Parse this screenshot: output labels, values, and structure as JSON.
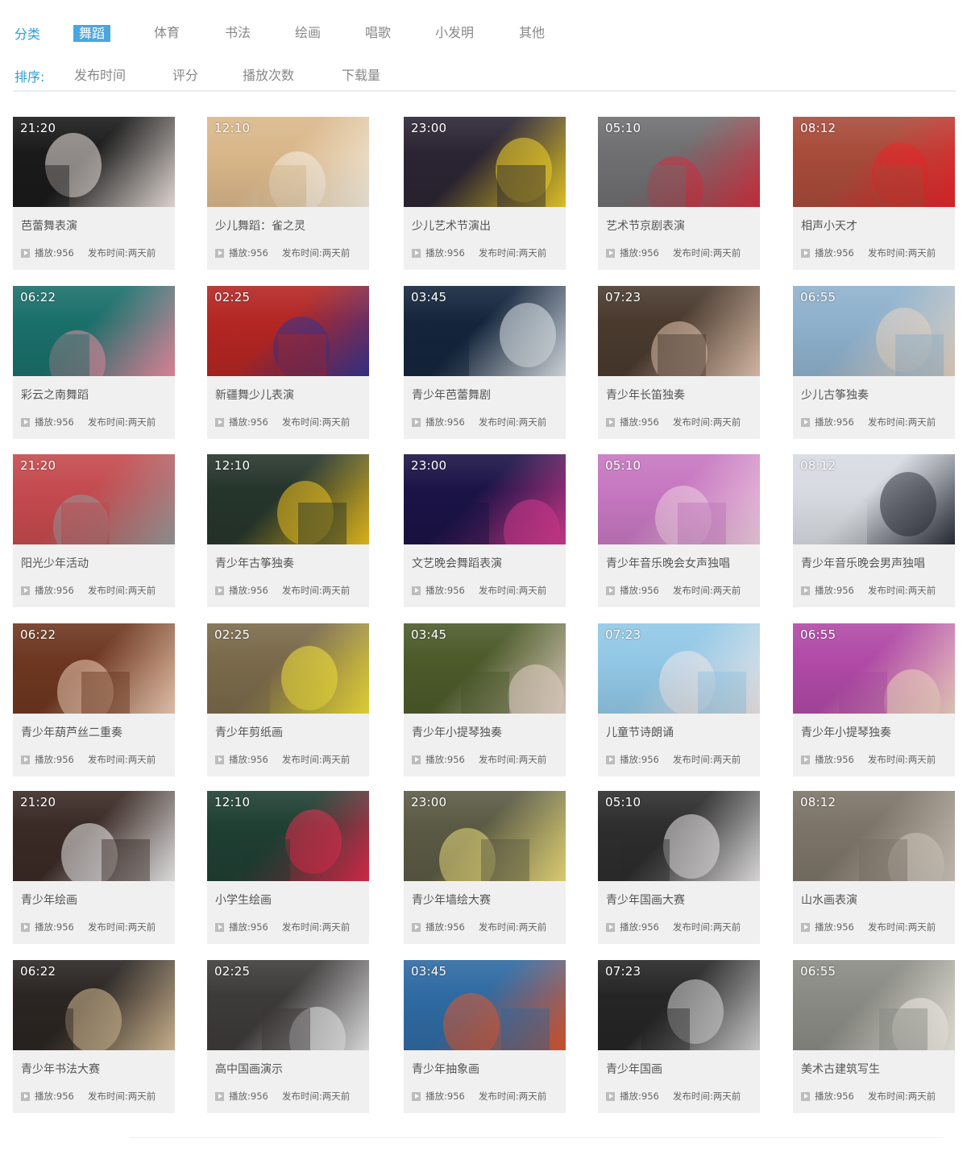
{
  "filters": {
    "category_label": "分类",
    "categories": [
      "舞蹈",
      "体育",
      "书法",
      "绘画",
      "唱歌",
      "小发明",
      "其他"
    ],
    "active_category": "舞蹈",
    "sort_label": "排序:",
    "sort_options": [
      "发布时间",
      "评分",
      "播放次数",
      "下载量"
    ]
  },
  "meta_labels": {
    "plays": "播放:",
    "published": "发布时间:"
  },
  "colors": {
    "accent": "#4aa6e0",
    "label": "#2a9fd8",
    "card_bg": "#f1f0f0"
  },
  "videos": [
    {
      "title": "芭蕾舞表演",
      "duration": "21:20",
      "plays": "956",
      "published": "两天前",
      "c1": "#1a1a1a",
      "c2": "#f3e9e4"
    },
    {
      "title": "少儿舞蹈：雀之灵",
      "duration": "12:10",
      "plays": "956",
      "published": "两天前",
      "c1": "#d9b78a",
      "c2": "#f7efe1"
    },
    {
      "title": "少儿艺术节演出",
      "duration": "23:00",
      "plays": "956",
      "published": "两天前",
      "c1": "#2b2533",
      "c2": "#f2d22a"
    },
    {
      "title": "艺术节京剧表演",
      "duration": "05:10",
      "plays": "956",
      "published": "两天前",
      "c1": "#6f6e70",
      "c2": "#d32f3f"
    },
    {
      "title": "相声小天才",
      "duration": "08:12",
      "plays": "956",
      "published": "两天前",
      "c1": "#a84b3a",
      "c2": "#e8242a"
    },
    {
      "title": "彩云之南舞蹈",
      "duration": "06:22",
      "plays": "956",
      "published": "两天前",
      "c1": "#1a6f6b",
      "c2": "#ef8fa4"
    },
    {
      "title": "新疆舞少儿表演",
      "duration": "02:25",
      "plays": "956",
      "published": "两天前",
      "c1": "#b32623",
      "c2": "#35338e"
    },
    {
      "title": "青少年芭蕾舞剧",
      "duration": "03:45",
      "plays": "956",
      "published": "两天前",
      "c1": "#14253c",
      "c2": "#dfe6ea"
    },
    {
      "title": "青少年长笛独奏",
      "duration": "07:23",
      "plays": "956",
      "published": "两天前",
      "c1": "#4a3a2e",
      "c2": "#e6c7b1"
    },
    {
      "title": "少儿古筝独奏",
      "duration": "06:55",
      "plays": "956",
      "published": "两天前",
      "c1": "#8fb1cc",
      "c2": "#e5d3c2"
    },
    {
      "title": "阳光少年活动",
      "duration": "21:20",
      "plays": "956",
      "published": "两天前",
      "c1": "#c44a4e",
      "c2": "#9a9a9a"
    },
    {
      "title": "青少年古筝独奏",
      "duration": "12:10",
      "plays": "956",
      "published": "两天前",
      "c1": "#26352c",
      "c2": "#f0c21f"
    },
    {
      "title": "文艺晚会舞蹈表演",
      "duration": "23:00",
      "plays": "956",
      "published": "两天前",
      "c1": "#1b1346",
      "c2": "#d63b8f"
    },
    {
      "title": "青少年音乐晚会女声独唱",
      "duration": "05:10",
      "plays": "956",
      "published": "两天前",
      "c1": "#c677c0",
      "c2": "#f1cfe2"
    },
    {
      "title": "青少年音乐晚会男声独唱",
      "duration": "08:12",
      "plays": "956",
      "published": "两天前",
      "c1": "#d7dbe1",
      "c2": "#2b2e38"
    },
    {
      "title": "青少年葫芦丝二重奏",
      "duration": "06:22",
      "plays": "956",
      "published": "两天前",
      "c1": "#6d3720",
      "c2": "#f3d0b8"
    },
    {
      "title": "青少年剪纸画",
      "duration": "02:25",
      "plays": "956",
      "published": "两天前",
      "c1": "#7a6a4b",
      "c2": "#f3e23a"
    },
    {
      "title": "青少年小提琴独奏",
      "duration": "03:45",
      "plays": "956",
      "published": "两天前",
      "c1": "#4c5a2a",
      "c2": "#e7d6c9"
    },
    {
      "title": "儿童节诗朗诵",
      "duration": "07:23",
      "plays": "956",
      "published": "两天前",
      "c1": "#92c8e6",
      "c2": "#f1e8e8"
    },
    {
      "title": "青少年小提琴独奏",
      "duration": "06:55",
      "plays": "956",
      "published": "两天前",
      "c1": "#b04aa6",
      "c2": "#f2d5c3"
    },
    {
      "title": "青少年绘画",
      "duration": "21:20",
      "plays": "956",
      "published": "两天前",
      "c1": "#3a2a25",
      "c2": "#f1f1f1"
    },
    {
      "title": "小学生绘画",
      "duration": "12:10",
      "plays": "956",
      "published": "两天前",
      "c1": "#1f3f33",
      "c2": "#e22b4d"
    },
    {
      "title": "青少年墙绘大赛",
      "duration": "23:00",
      "plays": "956",
      "published": "两天前",
      "c1": "#5a5a44",
      "c2": "#efe07d"
    },
    {
      "title": "青少年国画大赛",
      "duration": "05:10",
      "plays": "956",
      "published": "两天前",
      "c1": "#2d2d2d",
      "c2": "#eceaea"
    },
    {
      "title": "山水画表演",
      "duration": "08:12",
      "plays": "956",
      "published": "两天前",
      "c1": "#7c7468",
      "c2": "#cfc8bd"
    },
    {
      "title": "青少年书法大赛",
      "duration": "06:22",
      "plays": "956",
      "published": "两天前",
      "c1": "#2a2522",
      "c2": "#d9bf98"
    },
    {
      "title": "高中国画演示",
      "duration": "02:25",
      "plays": "956",
      "published": "两天前",
      "c1": "#3d3a3a",
      "c2": "#ececec"
    },
    {
      "title": "青少年抽象画",
      "duration": "03:45",
      "plays": "956",
      "published": "两天前",
      "c1": "#2f6aa2",
      "c2": "#e2572c"
    },
    {
      "title": "青少年国画",
      "duration": "07:23",
      "plays": "956",
      "published": "两天前",
      "c1": "#252525",
      "c2": "#d9d9d9"
    },
    {
      "title": "美术古建筑写生",
      "duration": "06:55",
      "plays": "956",
      "published": "两天前",
      "c1": "#8a8b84",
      "c2": "#f0ede4"
    }
  ]
}
